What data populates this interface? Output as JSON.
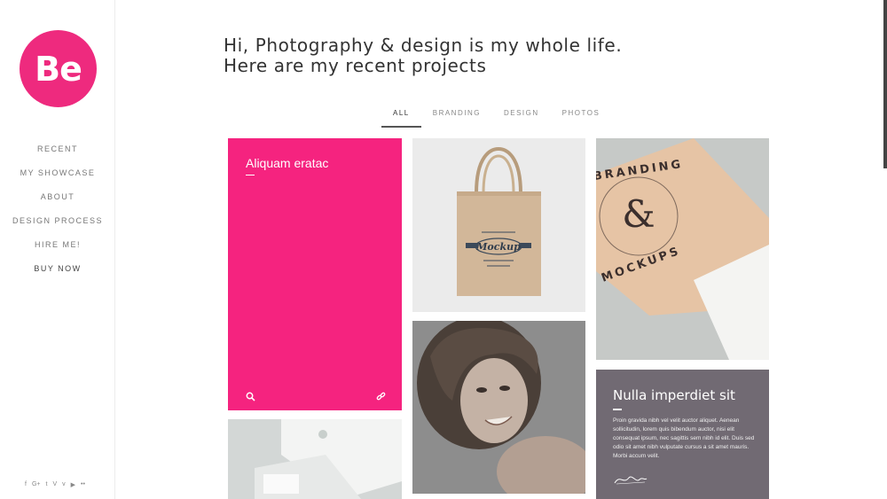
{
  "logo": {
    "text": "Be"
  },
  "nav": {
    "items": [
      "RECENT",
      "MY SHOWCASE",
      "ABOUT",
      "DESIGN PROCESS",
      "HIRE ME!",
      "BUY NOW"
    ]
  },
  "social": [
    "f",
    "G+",
    "t",
    "V",
    "v",
    "▶",
    "••"
  ],
  "headline": {
    "line1": "Hi, Photography & design is my whole life.",
    "line2": "Here are my recent projects"
  },
  "filters": [
    "ALL",
    "BRANDING",
    "DESIGN",
    "PHOTOS"
  ],
  "tiles": {
    "pink_title": "Aliquam eratac",
    "gray_title": "Nulla imperdiet sit",
    "gray_body": "Proin gravida nibh vel velit auctor aliquet. Aenean sollicitudin, lorem quis bibendum auctor, nisi elit consequat ipsum, nec sagittis sem nibh id elit. Duis sed odio sit amet nibh vulputate cursus a sit amet mauris. Morbi accum velit.",
    "bag_text": "Mockup",
    "brand_text_top": "BRANDING",
    "brand_text_bottom": "MOCKUPS"
  },
  "colors": {
    "accent": "#ee2a7e",
    "pink_tile": "#f5237f",
    "gray_tile": "#716a73"
  }
}
